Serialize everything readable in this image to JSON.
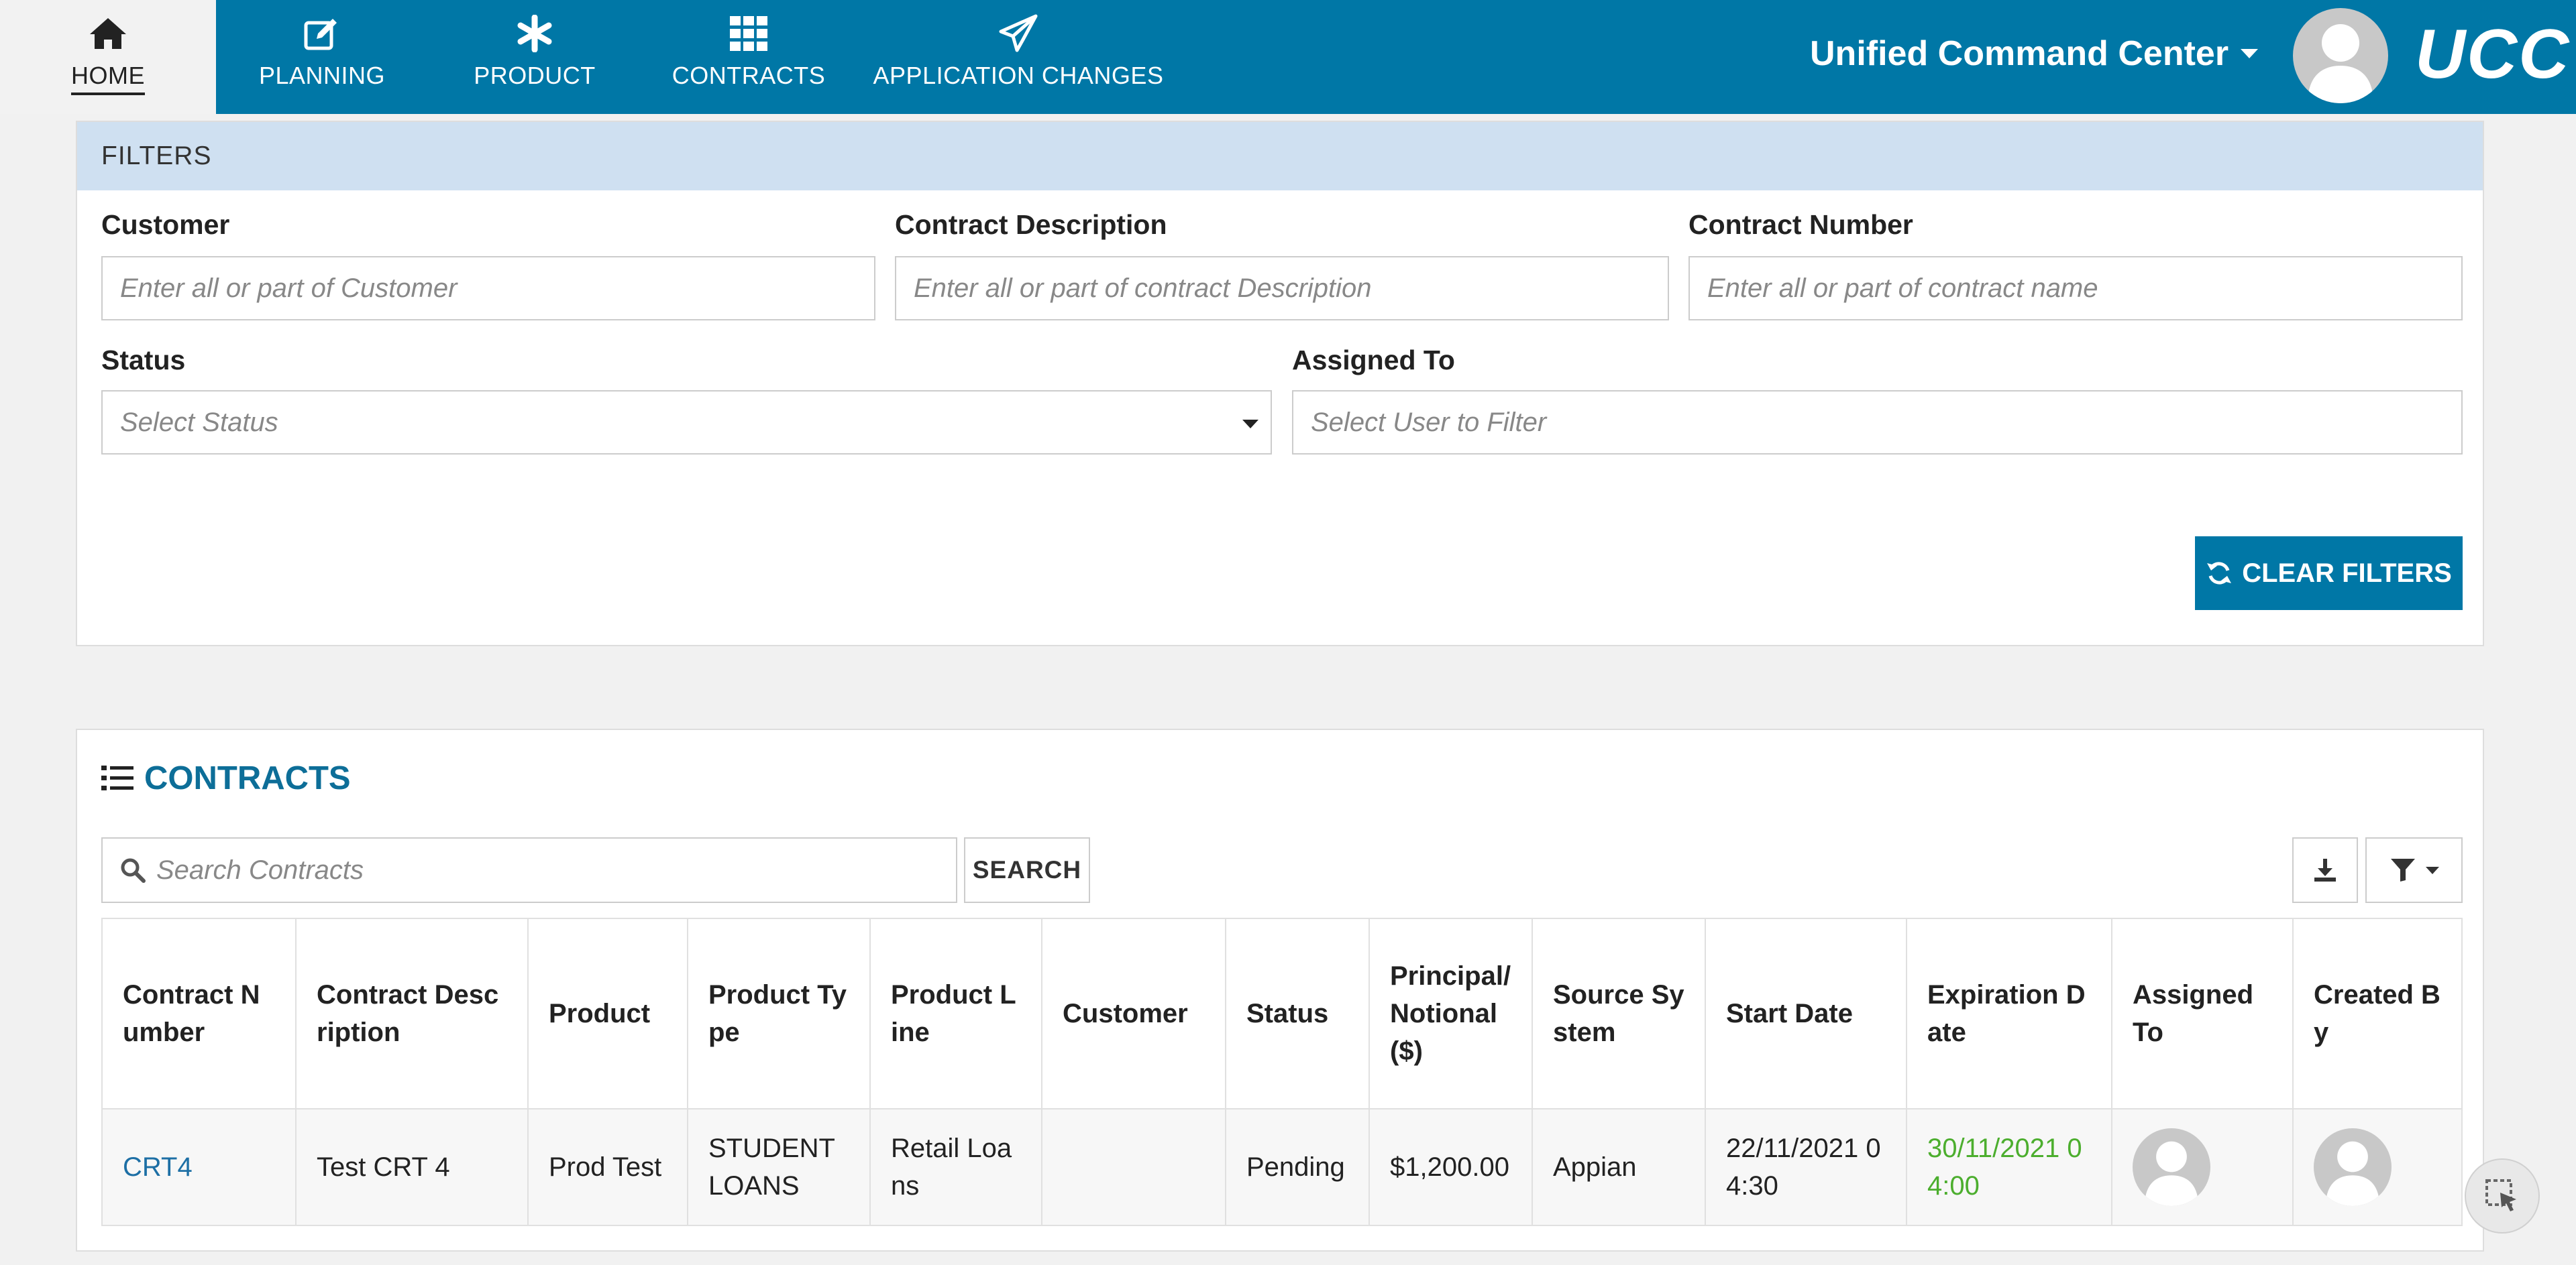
{
  "nav": {
    "tabs": [
      {
        "label": "HOME",
        "icon": "home-icon",
        "active": true
      },
      {
        "label": "PLANNING",
        "icon": "edit-icon"
      },
      {
        "label": "PRODUCT",
        "icon": "asterisk-icon"
      },
      {
        "label": "CONTRACTS",
        "icon": "grid-icon"
      },
      {
        "label": "APPLICATION CHANGES",
        "icon": "paper-plane-icon"
      }
    ],
    "app_title": "Unified Command Center",
    "logo": "UCC"
  },
  "filters": {
    "heading": "FILTERS",
    "customer_label": "Customer",
    "customer_placeholder": "Enter all or part of Customer",
    "description_label": "Contract Description",
    "description_placeholder": "Enter all or part of contract Description",
    "number_label": "Contract Number",
    "number_placeholder": "Enter all or part of contract name",
    "status_label": "Status",
    "status_placeholder": "Select Status",
    "assigned_label": "Assigned To",
    "assigned_placeholder": "Select User to Filter",
    "clear_label": "CLEAR FILTERS"
  },
  "contracts": {
    "heading": "CONTRACTS",
    "search_placeholder": "Search Contracts",
    "search_button": "SEARCH",
    "columns": [
      "Contract Number",
      "Contract Description",
      "Product",
      "Product Type",
      "Product Line",
      "Customer",
      "Status",
      "Principal/ Notional ($)",
      "Source System",
      "Start Date",
      "Expiration Date",
      "Assigned To",
      "Created By"
    ],
    "rows": [
      {
        "contract_number": "CRT4",
        "contract_description": "Test CRT 4",
        "product": "Prod Test",
        "product_type": "STUDENT LOANS",
        "product_line": "Retail Loans",
        "customer": "",
        "status": "Pending",
        "principal": "$1,200.00",
        "source_system": "Appian",
        "start_date": "22/11/2021 04:30",
        "expiration_date": "30/11/2021 04:00"
      }
    ]
  },
  "colors": {
    "primary": "#0077a6",
    "filters_header": "#cfe0f1",
    "link": "#1d6fa5",
    "expiration": "#4cae2e"
  }
}
